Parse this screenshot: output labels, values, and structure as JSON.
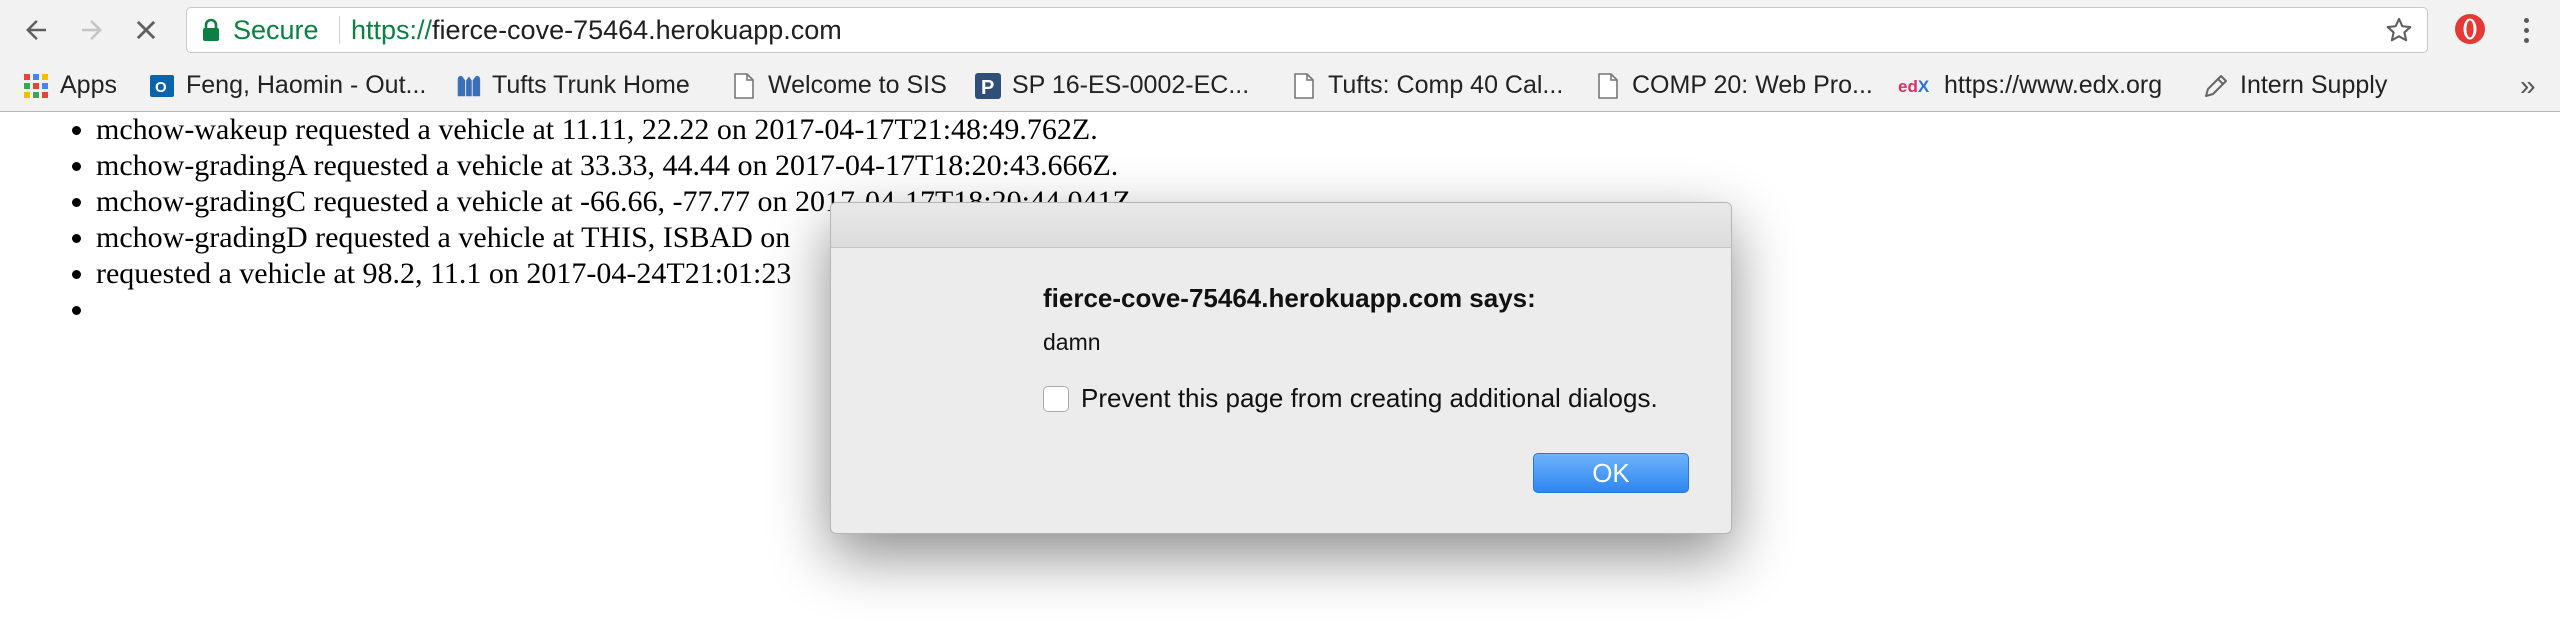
{
  "browser": {
    "secure_label": "Secure",
    "url_scheme": "https://",
    "url_host": "fierce-cove-75464.herokuapp.com",
    "accent_secure": "#0b8043",
    "bookmarks": [
      {
        "label": "Apps",
        "icon": "apps-grid-icon"
      },
      {
        "label": "Feng, Haomin - Out...",
        "icon": "outlook-icon"
      },
      {
        "label": "Tufts Trunk Home",
        "icon": "tufts-icon"
      },
      {
        "label": "Welcome to SIS",
        "icon": "page-icon"
      },
      {
        "label": "SP 16-ES-0002-EC...",
        "icon": "p-square-icon"
      },
      {
        "label": "Tufts: Comp 40 Cal...",
        "icon": "page-icon"
      },
      {
        "label": "COMP 20: Web Pro...",
        "icon": "page-icon"
      },
      {
        "label": "https://www.edx.org",
        "icon": "edx-icon"
      },
      {
        "label": "Intern Supply",
        "icon": "pencil-icon"
      }
    ],
    "bookmarks_overflow": "»"
  },
  "page": {
    "items": [
      "mchow-wakeup requested a vehicle at 11.11, 22.22 on 2017-04-17T21:48:49.762Z.",
      "mchow-gradingA requested a vehicle at 33.33, 44.44 on 2017-04-17T18:20:43.666Z.",
      "mchow-gradingC requested a vehicle at -66.66, -77.77 on 2017-04-17T18:20:44.041Z.",
      "mchow-gradingD requested a vehicle at THIS, ISBAD on",
      "requested a vehicle at 98.2, 11.1 on 2017-04-24T21:01:23",
      ""
    ]
  },
  "dialog": {
    "title": "fierce-cove-75464.herokuapp.com says:",
    "message": "damn",
    "checkbox_label": "Prevent this page from creating additional dialogs.",
    "ok_label": "OK",
    "accent": "#2d86f0"
  }
}
